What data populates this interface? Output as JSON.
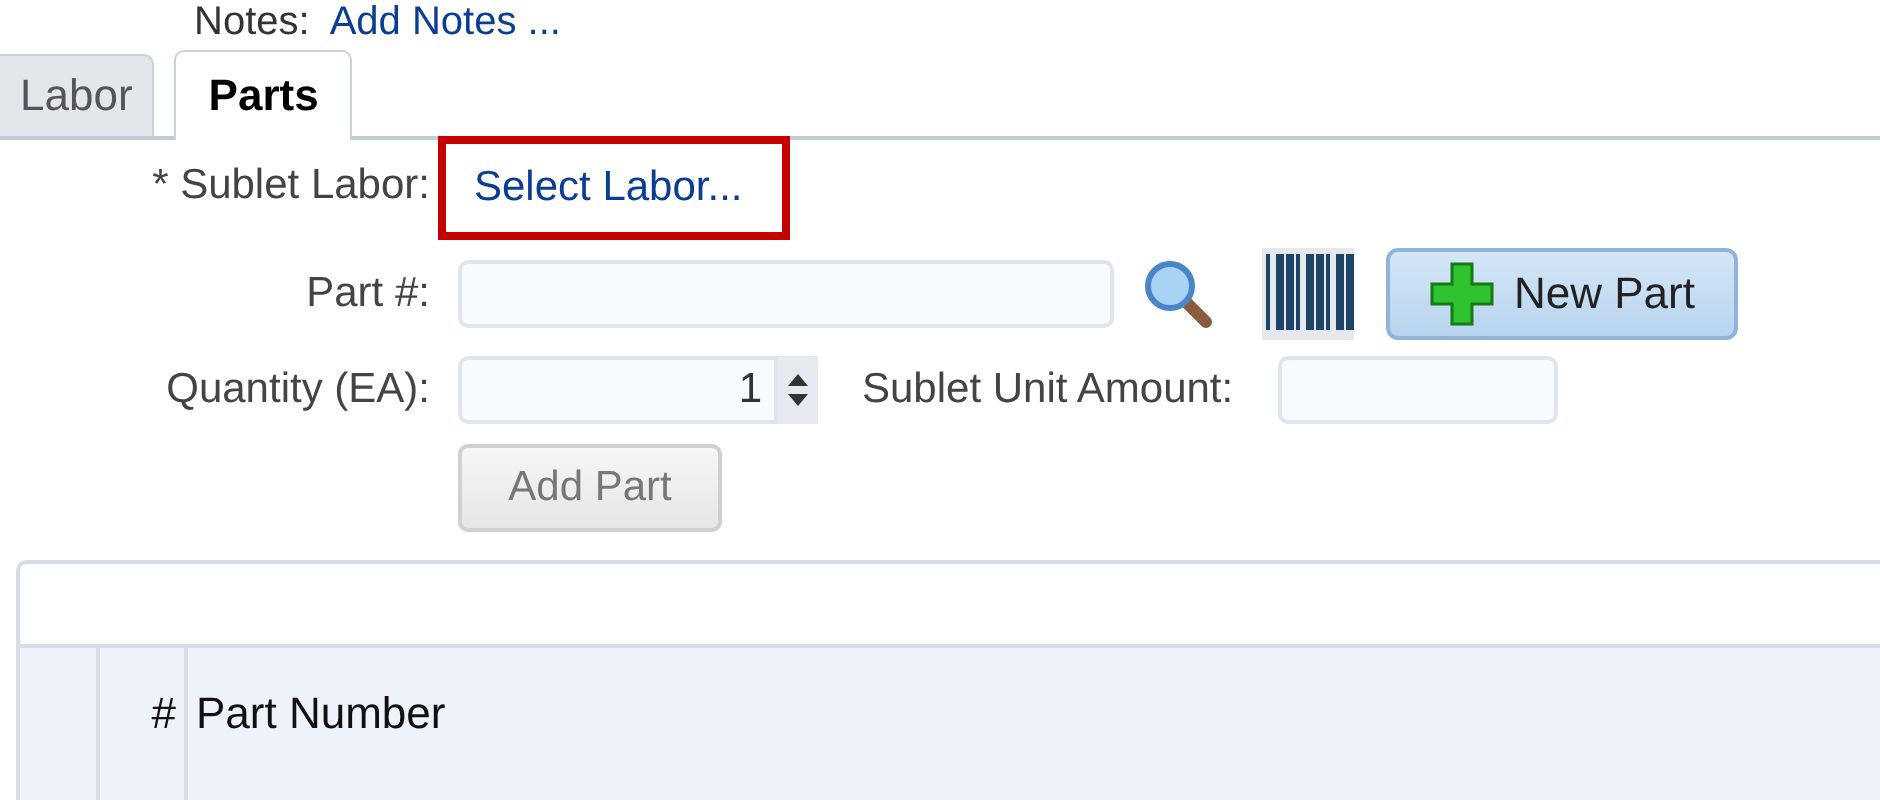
{
  "notes": {
    "label": "Notes:",
    "link": "Add Notes ..."
  },
  "tabs": [
    {
      "label": "Labor",
      "selected": false
    },
    {
      "label": "Parts",
      "selected": true
    }
  ],
  "form": {
    "sublet_labor": {
      "label": "* Sublet Labor:",
      "link": "Select Labor...",
      "highlighted": true
    },
    "part_number": {
      "label": "Part #:"
    },
    "new_part_button": "New Part",
    "quantity": {
      "label": "Quantity (EA):",
      "value": "1"
    },
    "sublet_unit_amount": {
      "label": "Sublet Unit Amount:"
    },
    "add_part_button": {
      "label": "Add Part",
      "disabled": true
    }
  },
  "table": {
    "columns": [
      "",
      "#",
      "Part Number"
    ]
  }
}
